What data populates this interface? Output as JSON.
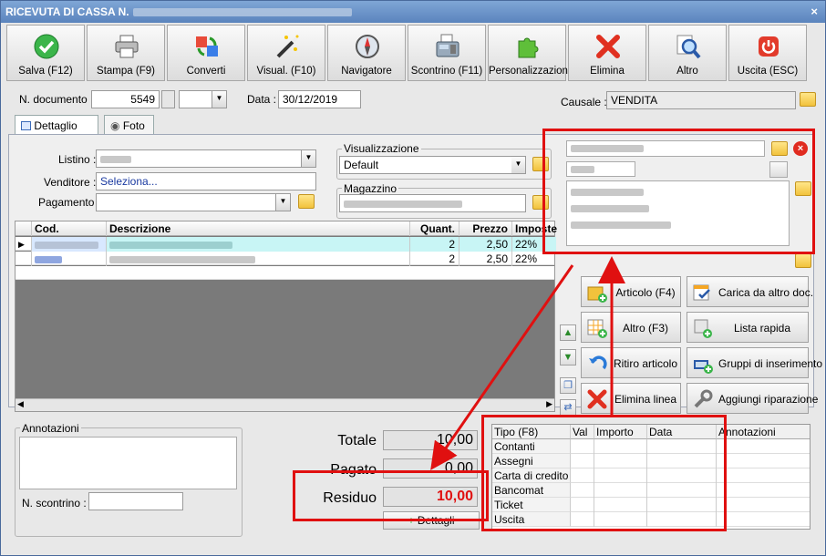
{
  "window": {
    "title": "RICEVUTA DI CASSA N.",
    "close": "×"
  },
  "toolbar": [
    {
      "label": "Salva (F12)",
      "icon": "check-icon"
    },
    {
      "label": "Stampa (F9)",
      "icon": "printer-icon"
    },
    {
      "label": "Converti",
      "icon": "convert-icon"
    },
    {
      "label": "Visual. (F10)",
      "icon": "magic-wand-icon"
    },
    {
      "label": "Navigatore",
      "icon": "compass-icon"
    },
    {
      "label": "Scontrino (F11)",
      "icon": "cash-register-icon"
    },
    {
      "label": "Personalizzazioni",
      "icon": "puzzle-icon"
    },
    {
      "label": "Elimina",
      "icon": "delete-x-icon"
    },
    {
      "label": "Altro",
      "icon": "magnifier-icon"
    },
    {
      "label": "Uscita (ESC)",
      "icon": "power-icon"
    }
  ],
  "header": {
    "doc_label": "N. documento :",
    "doc_value": "5549",
    "date_label": "Data :",
    "date_value": "30/12/2019",
    "causale_label": "Causale :",
    "causale_value": "VENDITA"
  },
  "tabs": [
    {
      "label": "Dettaglio (F5)"
    },
    {
      "label": "Foto"
    }
  ],
  "form": {
    "listino_label": "Listino :",
    "venditore_label": "Venditore :",
    "venditore_value": "Seleziona...",
    "pagamento_label": "Pagamento :",
    "visualizzazione_title": "Visualizzazione",
    "visualizzazione_value": "Default",
    "magazzino_title": "Magazzino"
  },
  "grid": {
    "columns": [
      "Cod.",
      "Descrizione",
      "Quant.",
      "Prezzo",
      "Imposte"
    ],
    "rows": [
      {
        "quant": "2",
        "prezzo": "2,50",
        "imposte": "22%"
      },
      {
        "quant": "2",
        "prezzo": "2,50",
        "imposte": "22%"
      }
    ]
  },
  "actions": [
    {
      "label": "Articolo (F4)",
      "icon": "add-article-icon"
    },
    {
      "label": "Carica da altro doc.",
      "icon": "load-doc-icon"
    },
    {
      "label": "Altro (F3)",
      "icon": "add-grid-icon"
    },
    {
      "label": "Lista rapida",
      "icon": "quick-list-icon"
    },
    {
      "label": "Ritiro articolo",
      "icon": "return-arrow-icon"
    },
    {
      "label": "Gruppi di inserimento",
      "icon": "insert-group-icon"
    },
    {
      "label": "Elimina linea",
      "icon": "delete-line-icon"
    },
    {
      "label": "Aggiungi riparazione",
      "icon": "wrench-icon"
    }
  ],
  "annotazioni": {
    "title": "Annotazioni",
    "scontrino_label": "N. scontrino :"
  },
  "totals": {
    "totale_label": "Totale",
    "totale_value": "10,00",
    "pagato_label": "Pagato",
    "pagato_value": "0,00",
    "residuo_label": "Residuo",
    "residuo_value": "10,00",
    "dettagli_label": "Dettagli",
    "residuo_color": "#e01010"
  },
  "payments": {
    "columns": [
      "Tipo (F8)",
      "Val",
      "Importo",
      "Data",
      "Annotazioni"
    ],
    "types": [
      "Contanti",
      "Assegni",
      "Carta di credito",
      "Bancomat",
      "Ticket",
      "Uscita"
    ]
  }
}
